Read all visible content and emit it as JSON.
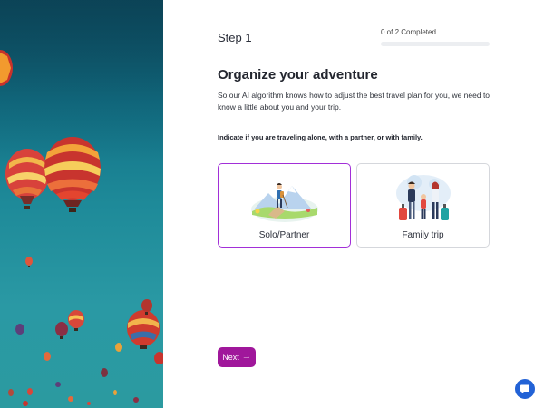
{
  "header": {
    "step_label": "Step 1",
    "progress_text": "0 of 2 Completed",
    "progress_completed": 0,
    "progress_total": 2
  },
  "content": {
    "title": "Organize your adventure",
    "description": "So our AI algorithm knows how to adjust the best travel plan for you, we need to know a little about you and your trip.",
    "instruction": "Indicate if you are traveling alone, with a partner, or with family."
  },
  "options": [
    {
      "label": "Solo/Partner",
      "selected": true,
      "icon": "hiker-illustration"
    },
    {
      "label": "Family trip",
      "selected": false,
      "icon": "family-travel-illustration"
    }
  ],
  "actions": {
    "next_label": "Next",
    "next_icon": "arrow-right-icon"
  },
  "chat": {
    "icon": "chat-bubble-icon"
  },
  "colors": {
    "accent": "#a22fd8",
    "button": "#a0179b",
    "chat": "#2262d6"
  }
}
